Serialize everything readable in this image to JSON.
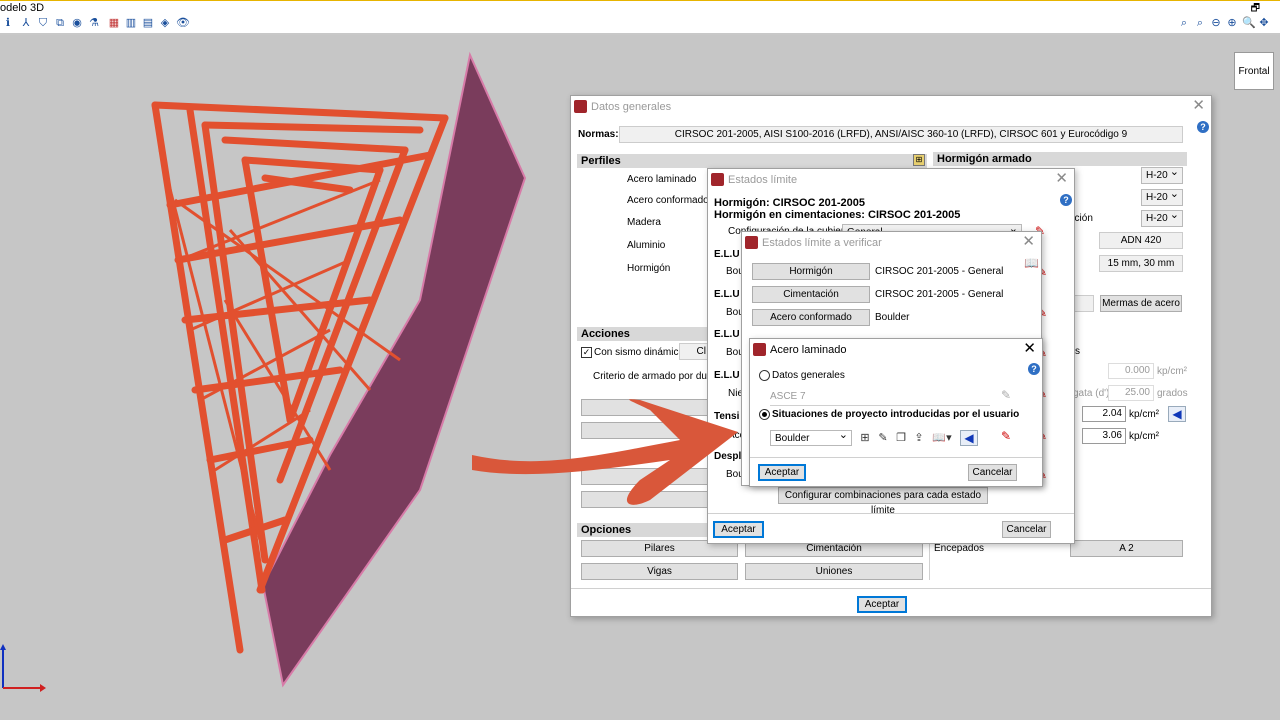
{
  "app": {
    "title": "odelo 3D",
    "view_label": "Frontal"
  },
  "datos_generales": {
    "title": "Datos generales",
    "normas_label": "Normas:",
    "normas_value": "CIRSOC 201-2005, AISI S100-2016 (LRFD), ANSI/AISC 360-10 (LRFD), CIRSOC 601 y Eurocódigo 9",
    "perfiles_header": "Perfiles",
    "perfiles": [
      "Acero laminado",
      "Acero conformado",
      "Madera",
      "Aluminio",
      "Hormigón"
    ],
    "hormigon_header": "Hormigón armado",
    "hormigon_selects": [
      "H-20",
      "H-20",
      "H-20"
    ],
    "hormigon_partial_label": "ación",
    "adn_value": "ADN 420",
    "recub_value": "15 mm, 30 mm",
    "mermas_label": "Mermas de acero",
    "acciones_header": "Acciones",
    "sismo_label": "Con sismo dinámico",
    "sismo_partial": "Cl",
    "criterio_label": "Criterio de armado por ductilid",
    "s_label": "s",
    "val_0000": "0.000",
    "unit_kpcm2": "kp/cm²",
    "angle_partial": "gata (d')",
    "val_2500": "25.00",
    "unit_grados": "grados",
    "val_204": "2.04",
    "val_306": "3.06",
    "opciones_header": "Opciones",
    "opciones": [
      "Pilares",
      "Cimentación",
      "Vigas",
      "Uniones"
    ],
    "encepados_label": "Encepados",
    "encepados_value": "A 2",
    "aceptar": "Aceptar"
  },
  "estados_limite": {
    "title": "Estados límite",
    "hormigon_line": "Hormigón: CIRSOC 201-2005",
    "cimentaciones_line": "Hormigón en cimentaciones: CIRSOC 201-2005",
    "config_label": "Configuración de la cubierta",
    "config_value": "General",
    "elu": [
      "E.L.U",
      "E.L.U",
      "E.L.U",
      "E.L.U"
    ],
    "boul": [
      "Boul",
      "Boul",
      "Boul"
    ],
    "nie": "Nie",
    "tensi": "Tensi",
    "acc": "Acc",
    "despl": "Despl",
    "boul2": "Boul",
    "config_comb_label": "Configurar combinaciones para cada estado límite",
    "aceptar": "Aceptar",
    "cancelar": "Cancelar"
  },
  "estados_verificar": {
    "title": "Estados límite a verificar",
    "rows": [
      {
        "button": "Hormigón",
        "value": "CIRSOC 201-2005 - General"
      },
      {
        "button": "Cimentación",
        "value": "CIRSOC 201-2005 - General"
      },
      {
        "button": "Acero conformado",
        "value": "Boulder"
      }
    ]
  },
  "acero_laminado": {
    "title": "Acero laminado",
    "radio_general": "Datos generales",
    "asce_value": "ASCE 7",
    "radio_usuario": "Situaciones de proyecto introducidas por el usuario",
    "boulder_value": "Boulder",
    "aceptar": "Aceptar",
    "cancelar": "Cancelar"
  },
  "colors": {
    "frame": "#e2502f",
    "plane": "#7a3c5c",
    "arrow": "#d9573a",
    "accent_blue": "#0078d7"
  }
}
